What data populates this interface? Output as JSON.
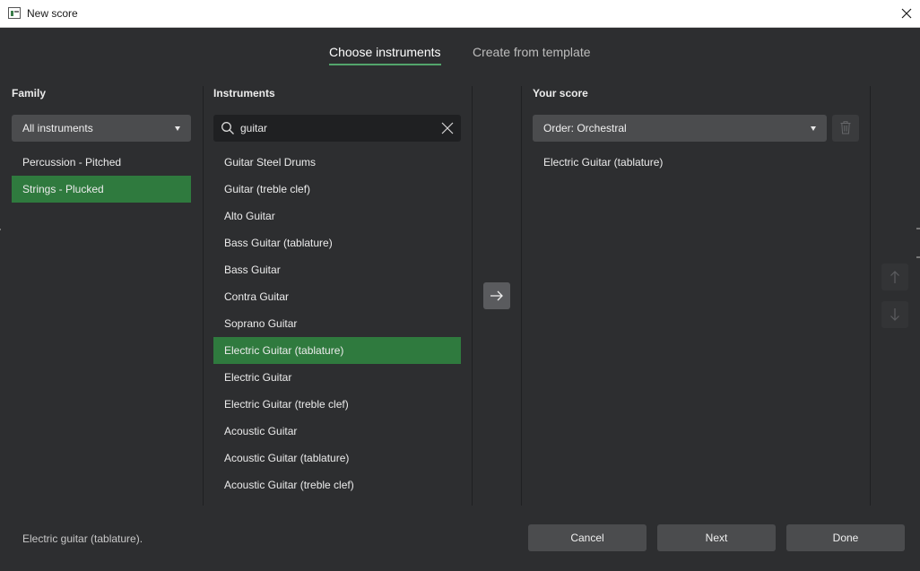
{
  "window": {
    "title": "New score"
  },
  "tabs": [
    {
      "label": "Choose instruments",
      "active": true
    },
    {
      "label": "Create from template",
      "active": false
    }
  ],
  "family": {
    "heading": "Family",
    "dropdown_value": "All instruments",
    "items": [
      {
        "label": "Percussion - Pitched",
        "selected": false
      },
      {
        "label": "Strings - Plucked",
        "selected": true
      }
    ]
  },
  "instruments": {
    "heading": "Instruments",
    "search_value": "guitar",
    "items": [
      {
        "label": "Guitar Steel Drums",
        "selected": false
      },
      {
        "label": "Guitar (treble clef)",
        "selected": false
      },
      {
        "label": "Alto Guitar",
        "selected": false
      },
      {
        "label": "Bass Guitar (tablature)",
        "selected": false
      },
      {
        "label": "Bass Guitar",
        "selected": false
      },
      {
        "label": "Contra Guitar",
        "selected": false
      },
      {
        "label": "Soprano Guitar",
        "selected": false
      },
      {
        "label": "Electric Guitar (tablature)",
        "selected": true
      },
      {
        "label": "Electric Guitar",
        "selected": false
      },
      {
        "label": "Electric Guitar (treble clef)",
        "selected": false
      },
      {
        "label": "Acoustic Guitar",
        "selected": false
      },
      {
        "label": "Acoustic Guitar (tablature)",
        "selected": false
      },
      {
        "label": "Acoustic Guitar (treble clef)",
        "selected": false
      }
    ]
  },
  "score": {
    "heading": "Your score",
    "order_value": "Order: Orchestral",
    "items": [
      {
        "label": "Electric Guitar (tablature)"
      }
    ]
  },
  "footer": {
    "hint": "Electric guitar (tablature).",
    "cancel_label": "Cancel",
    "next_label": "Next",
    "done_label": "Done"
  },
  "icons": {
    "app": "app-icon",
    "close": "close-icon",
    "search": "search-icon",
    "clear": "clear-search-icon",
    "add": "arrow-right-icon",
    "delete": "trash-icon",
    "up": "arrow-up-icon",
    "down": "arrow-down-icon",
    "dropdown": "caret-down-icon"
  },
  "colors": {
    "background": "#2d2e30",
    "accent": "#53a56c",
    "selection": "#2f7a3e",
    "button": "#4b4c4e"
  }
}
